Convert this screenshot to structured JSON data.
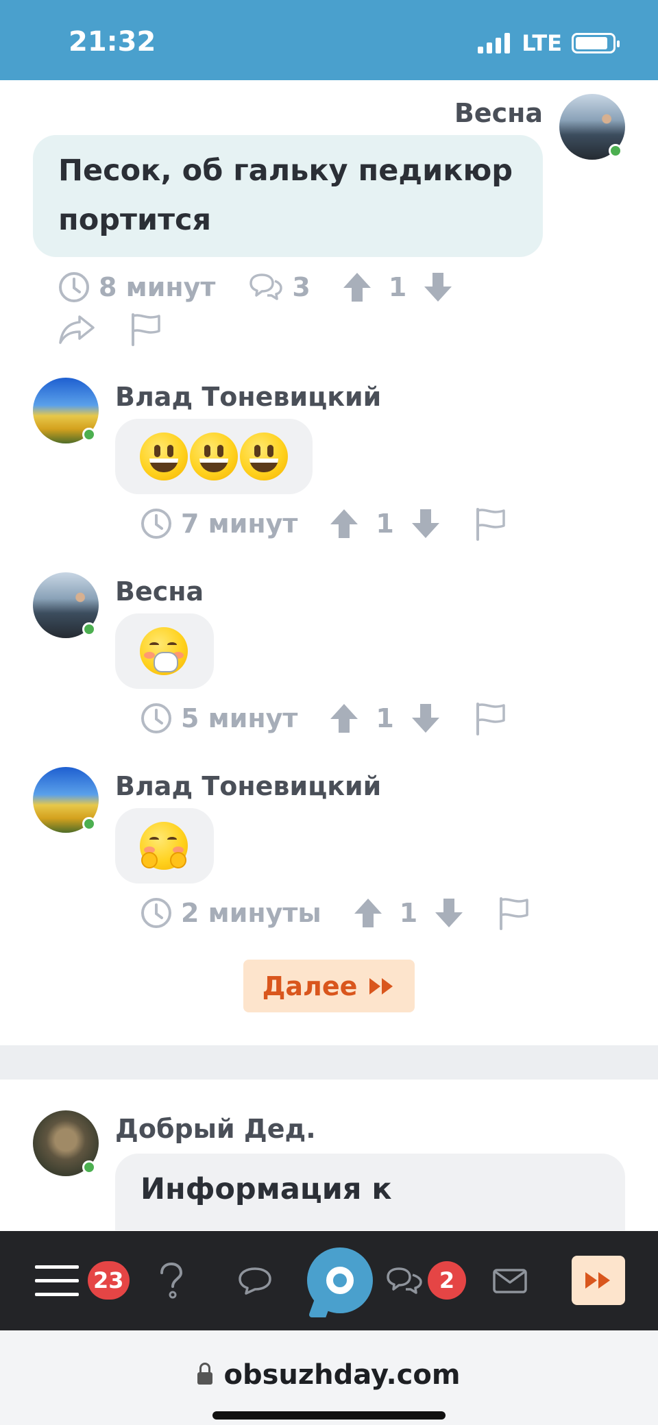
{
  "status_bar": {
    "time": "21:32",
    "network": "LTE"
  },
  "comments": [
    {
      "author": "Весна",
      "text": "Песок, об гальку педикюр портится",
      "time": "8 минут",
      "replies": "3",
      "score": "1",
      "avatar_icon": "mountain-photo"
    },
    {
      "author": "Влад Тоневицкий",
      "emoji": "grinning-face-x3",
      "time": "7 минут",
      "score": "1",
      "avatar_icon": "tulip-field-photo"
    },
    {
      "author": "Весна",
      "emoji": "face-with-hand-over-mouth",
      "time": "5 минут",
      "score": "1",
      "avatar_icon": "mountain-photo"
    },
    {
      "author": "Влад Тоневицкий",
      "emoji": "hugging-face",
      "time": "2 минуты",
      "score": "1",
      "avatar_icon": "tulip-field-photo"
    }
  ],
  "more_button": {
    "label": "Далее"
  },
  "next_post": {
    "author": "Добрый Дед.",
    "text": "Информация к",
    "avatar_icon": "elder-portrait"
  },
  "bottom_nav": {
    "menu_badge": "23",
    "messages_badge": "2"
  },
  "browser": {
    "url": "obsuzhday.com"
  },
  "colors": {
    "header_blue": "#4aa0cd",
    "accent_orange": "#d9561d",
    "badge_red": "#e54545",
    "online_green": "#4caf50"
  }
}
